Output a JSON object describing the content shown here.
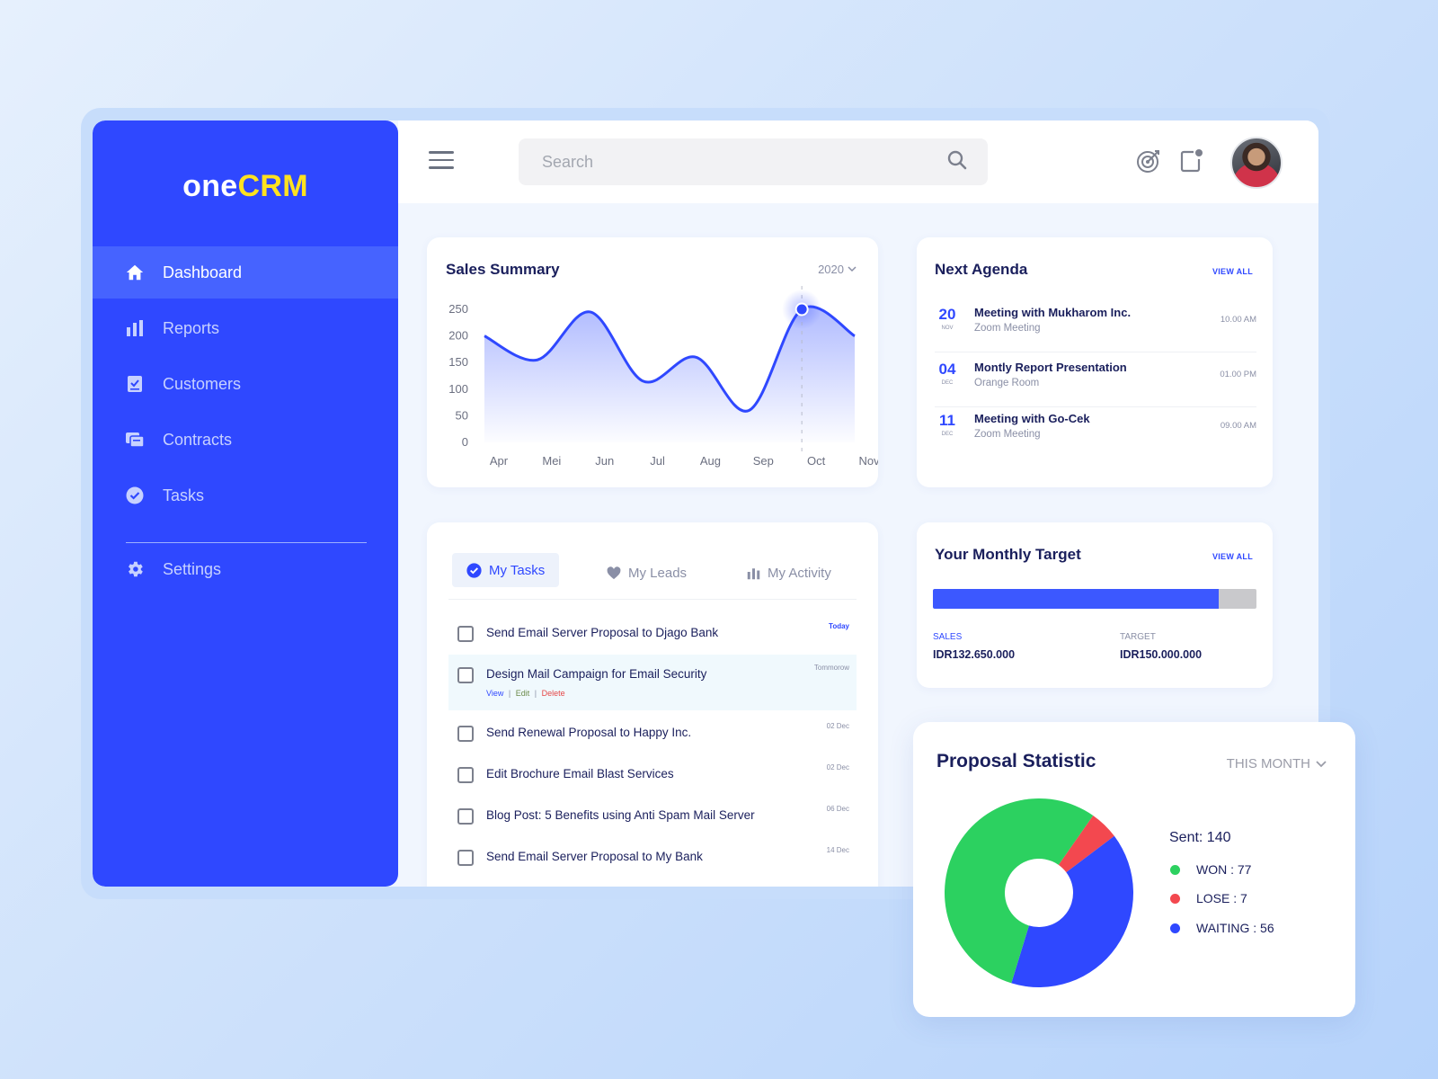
{
  "brand": {
    "prefix": "one",
    "accent": "CRM"
  },
  "sidebar": {
    "items": [
      {
        "label": "Dashboard",
        "icon": "home-icon"
      },
      {
        "label": "Reports",
        "icon": "bar-chart-icon"
      },
      {
        "label": "Customers",
        "icon": "clipboard-check-icon"
      },
      {
        "label": "Contracts",
        "icon": "contracts-icon"
      },
      {
        "label": "Tasks",
        "icon": "check-circle-icon"
      }
    ],
    "settings": {
      "label": "Settings",
      "icon": "gear-icon"
    }
  },
  "header": {
    "search_placeholder": "Search",
    "icons": [
      "hamburger-icon",
      "search-icon",
      "target-icon",
      "notification-icon",
      "avatar"
    ]
  },
  "sales_summary": {
    "title": "Sales Summary",
    "year": "2020",
    "chart_data": {
      "type": "area",
      "categories": [
        "Apr",
        "Mei",
        "Jun",
        "Jul",
        "Aug",
        "Sep",
        "Oct",
        "Nov"
      ],
      "yticks": [
        "250",
        "200",
        "150",
        "100",
        "50",
        "0"
      ],
      "ylim": [
        0,
        250
      ],
      "series": [
        {
          "values": [
            200,
            155,
            245,
            115,
            160,
            60,
            250,
            200
          ]
        }
      ],
      "highlight": {
        "category": "Oct",
        "value": 250
      },
      "color": "#2f48ff"
    }
  },
  "agenda": {
    "title": "Next Agenda",
    "view_all": "VIEW ALL",
    "items": [
      {
        "day": "20",
        "month": "NOV",
        "title": "Meeting with Mukharom Inc.",
        "subtitle": "Zoom Meeting",
        "time": "10.00 AM"
      },
      {
        "day": "04",
        "month": "DEC",
        "title": "Montly Report Presentation",
        "subtitle": "Orange Room",
        "time": "01.00 PM"
      },
      {
        "day": "11",
        "month": "DEC",
        "title": "Meeting with Go-Cek",
        "subtitle": "Zoom Meeting",
        "time": "09.00 AM"
      }
    ]
  },
  "tasks": {
    "tabs": [
      {
        "label": "My Tasks",
        "icon": "check-circle-icon",
        "active": true
      },
      {
        "label": "My Leads",
        "icon": "heart-icon",
        "active": false
      },
      {
        "label": "My Activity",
        "icon": "bar-chart-icon",
        "active": false
      }
    ],
    "items": [
      {
        "label": "Send Email Server Proposal to Djago Bank",
        "date": "Today"
      },
      {
        "label": "Design Mail Campaign for Email Security",
        "date": "Tommorow"
      },
      {
        "label": "Send Renewal Proposal to Happy Inc.",
        "date": "02 Dec"
      },
      {
        "label": "Edit Brochure Email Blast Services",
        "date": "02 Dec"
      },
      {
        "label": "Blog Post: 5 Benefits using Anti Spam Mail Server",
        "date": "06 Dec"
      },
      {
        "label": "Send Email Server Proposal to My Bank",
        "date": "14 Dec"
      }
    ],
    "actions": {
      "view": "View",
      "edit": "Edit",
      "delete": "Delete",
      "separator": "|"
    }
  },
  "monthly_target": {
    "title": "Your Monthly Target",
    "view_all": "VIEW ALL",
    "progress": 0.8843,
    "sales_label": "SALES",
    "sales_value": "IDR132.650.000",
    "target_label": "TARGET",
    "target_value": "IDR150.000.000"
  },
  "proposal": {
    "title": "Proposal Statistic",
    "period": "THIS MONTH",
    "sent": "Sent: 140",
    "chart_data": {
      "type": "pie",
      "labels": [
        "WON",
        "LOSE",
        "WAITING"
      ],
      "values": [
        77,
        7,
        56
      ],
      "colors": [
        "#2cd160",
        "#f3484f",
        "#2f48ff"
      ]
    },
    "legend": [
      {
        "text": "WON : 77",
        "color": "#2cd160"
      },
      {
        "text": "LOSE : 7",
        "color": "#f3484f"
      },
      {
        "text": "WAITING : 56",
        "color": "#2f48ff"
      }
    ]
  },
  "colors": {
    "primary": "#2f48ff",
    "brand_accent": "#ffe21f",
    "sidebar_active": "#4663ff"
  }
}
